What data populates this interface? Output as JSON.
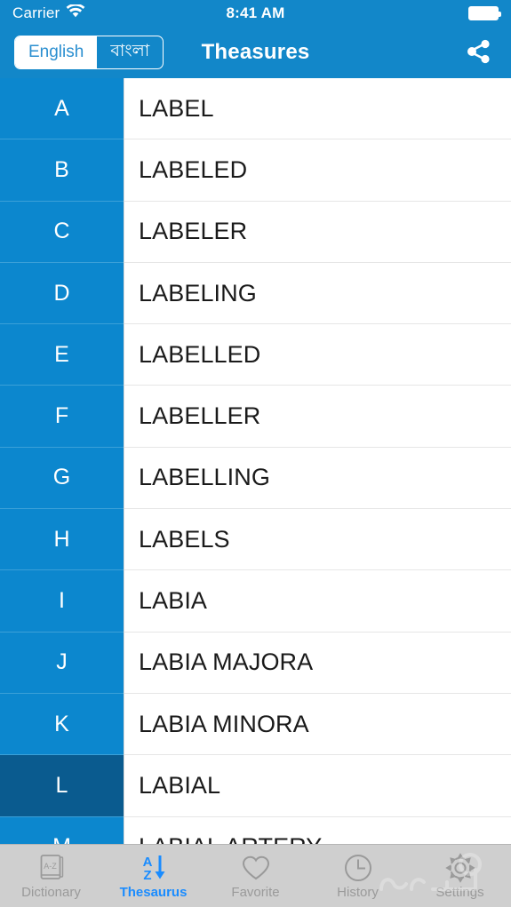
{
  "status_bar": {
    "carrier": "Carrier",
    "wifi_icon": "wifi-icon",
    "time": "8:41 AM",
    "battery_icon": "battery-full-icon"
  },
  "nav_bar": {
    "title": "Theasures",
    "share_icon": "share-icon",
    "language_segments": [
      {
        "label": "English",
        "selected": true
      },
      {
        "label": "বাংলা",
        "selected": false
      }
    ]
  },
  "alphabet_rail": {
    "selected_letter": "L",
    "letters": [
      "A",
      "B",
      "C",
      "D",
      "E",
      "F",
      "G",
      "H",
      "I",
      "J",
      "K",
      "L",
      "M"
    ]
  },
  "word_list": {
    "words": [
      "LABEL",
      "LABELED",
      "LABELER",
      "LABELING",
      "LABELLED",
      "LABELLER",
      "LABELLING",
      "LABELS",
      "LABIA",
      "LABIA MAJORA",
      "LABIA MINORA",
      "LABIAL",
      "LABIAL ARTERY"
    ]
  },
  "tab_bar": {
    "tabs": [
      {
        "label": "Dictionary",
        "icon": "book-az-icon",
        "active": false
      },
      {
        "label": "Thesaurus",
        "icon": "sort-az-down-icon",
        "active": true
      },
      {
        "label": "Favorite",
        "icon": "heart-icon",
        "active": false
      },
      {
        "label": "History",
        "icon": "clock-icon",
        "active": false
      },
      {
        "label": "Settings",
        "icon": "gear-icon",
        "active": false
      }
    ]
  },
  "colors": {
    "header_blue": "#1287c9",
    "rail_blue": "#0c87ce",
    "rail_selected_blue": "#0a5b8f",
    "accent_blue": "#1a8cff",
    "tabbar_gray": "#cfcfcf",
    "inactive_gray": "#9a9a9a"
  }
}
